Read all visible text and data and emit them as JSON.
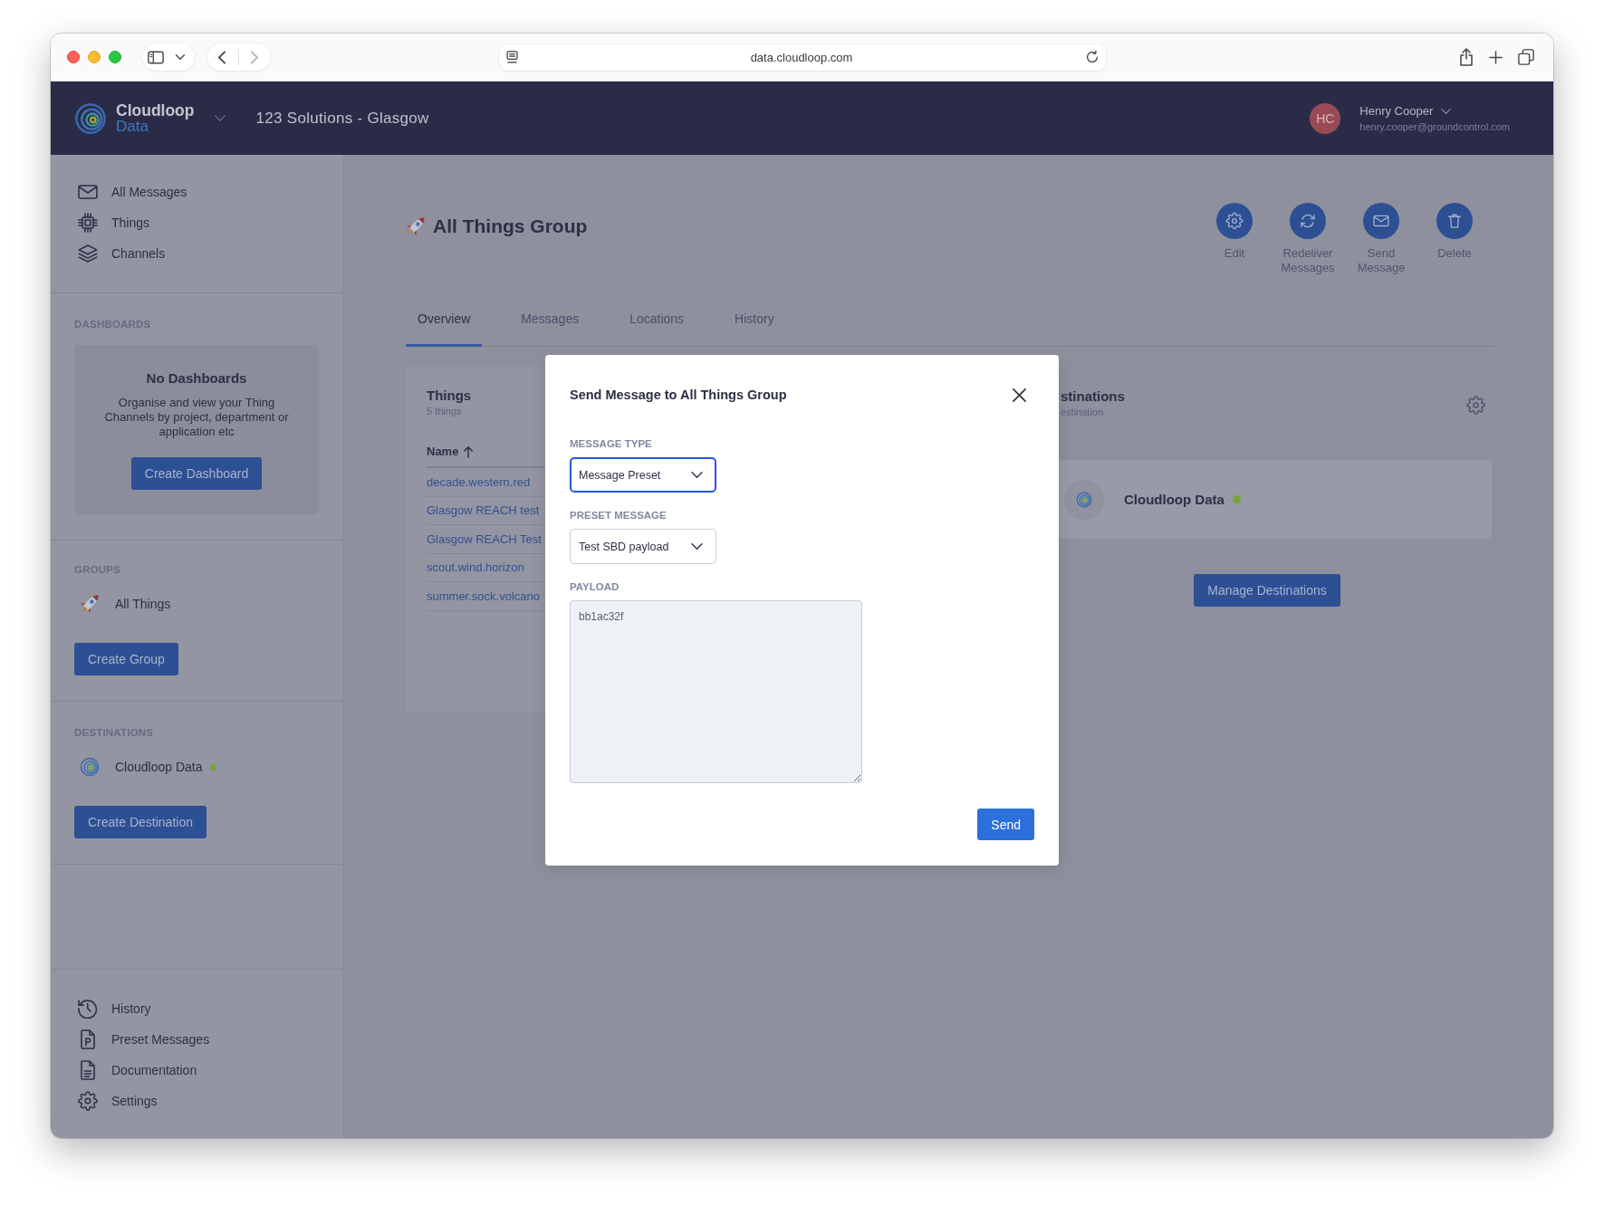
{
  "browser": {
    "url": "data.cloudloop.com"
  },
  "header": {
    "logo": {
      "name": "Cloudloop",
      "product": "Data"
    },
    "organization": "123 Solutions - Glasgow",
    "user": {
      "initials": "HC",
      "name": "Henry Cooper",
      "email": "henry.cooper@groundcontrol.com"
    }
  },
  "sidebar": {
    "nav": [
      {
        "label": "All Messages"
      },
      {
        "label": "Things"
      },
      {
        "label": "Channels"
      }
    ],
    "dashboards": {
      "heading": "DASHBOARDS",
      "empty_title": "No Dashboards",
      "empty_text": "Organise and view your Thing Channels by project, department or application etc",
      "button": "Create Dashboard"
    },
    "groups": {
      "heading": "GROUPS",
      "items": [
        {
          "label": "All Things"
        }
      ],
      "button": "Create Group"
    },
    "destinations": {
      "heading": "DESTINATIONS",
      "items": [
        {
          "label": "Cloudloop Data",
          "color": "#77a33a"
        }
      ],
      "button": "Create Destination"
    },
    "footer_nav": [
      {
        "label": "History"
      },
      {
        "label": "Preset Messages"
      },
      {
        "label": "Documentation"
      },
      {
        "label": "Settings"
      }
    ]
  },
  "page": {
    "title": "All Things Group",
    "actions": [
      {
        "label": "Edit"
      },
      {
        "label": "Redeliver Messages"
      },
      {
        "label": "Send Message"
      },
      {
        "label": "Delete"
      }
    ],
    "tabs": [
      {
        "label": "Overview",
        "selected": true
      },
      {
        "label": "Messages",
        "selected": false
      },
      {
        "label": "Locations",
        "selected": false
      },
      {
        "label": "History",
        "selected": false
      }
    ],
    "things": {
      "title": "Things",
      "subtitle": "5 things",
      "column": "Name",
      "rows": [
        "decade.western.red",
        "Glasgow REACH test",
        "Glasgow REACH Test",
        "scout.wind.horizon",
        "summer.sock.volcano"
      ]
    },
    "destinations": {
      "title": "stinations",
      "subtitle": "estination",
      "items": [
        {
          "name": "Cloudloop Data",
          "color": "#77a33a"
        }
      ],
      "button": "Manage Destinations"
    }
  },
  "modal": {
    "title": "Send Message to All Things Group",
    "fields": [
      {
        "kind": "select",
        "label": "MESSAGE TYPE",
        "value": "Message Preset",
        "focused": true
      },
      {
        "kind": "select",
        "label": "PRESET MESSAGE",
        "value": "Test SBD payload",
        "focused": false
      },
      {
        "kind": "textarea",
        "label": "PAYLOAD",
        "value": "bb1ac32f"
      }
    ],
    "button": "Send"
  }
}
